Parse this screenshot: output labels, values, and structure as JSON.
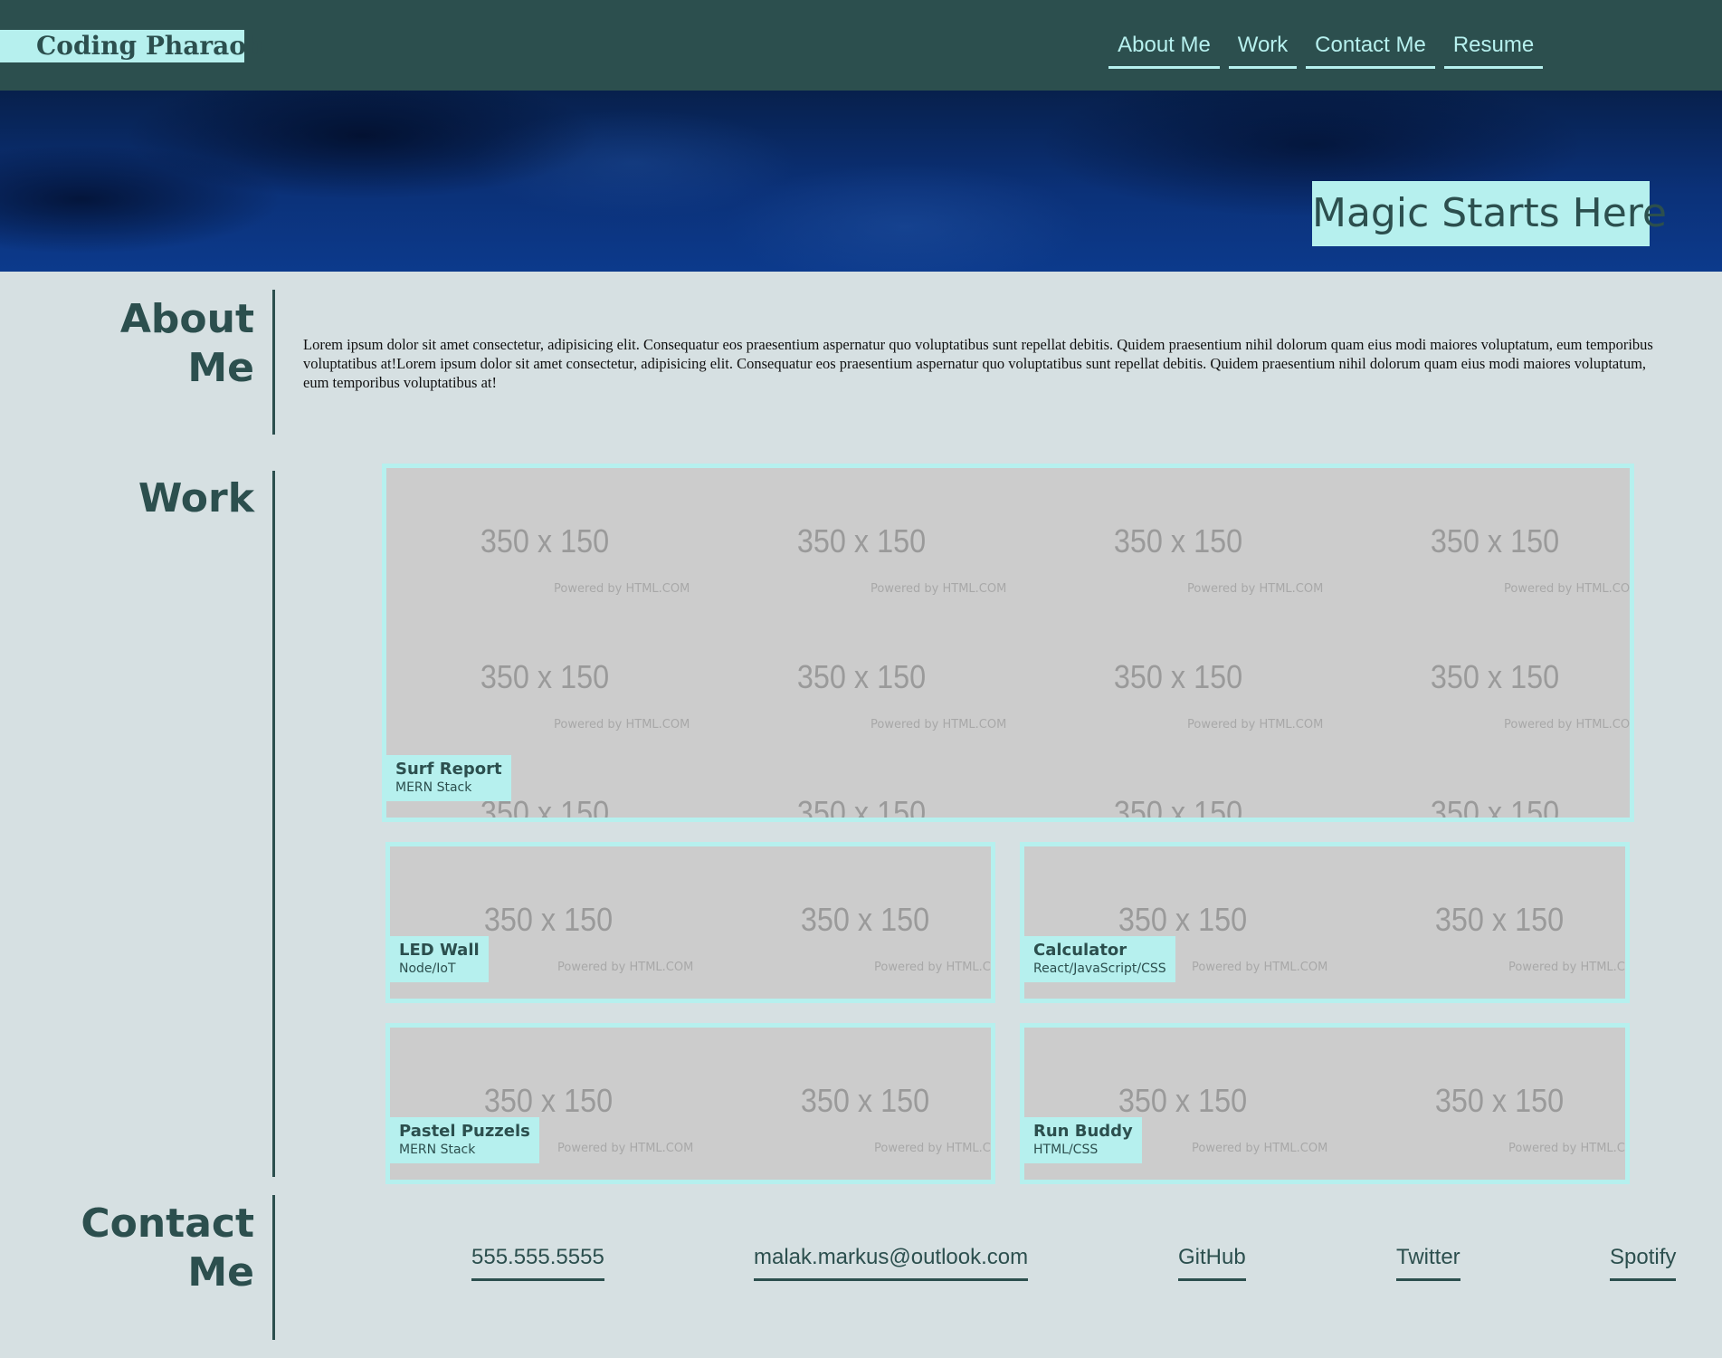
{
  "header": {
    "logo": "Coding Pharaoh",
    "nav": [
      {
        "label": "About Me"
      },
      {
        "label": "Work"
      },
      {
        "label": "Contact Me"
      },
      {
        "label": "Resume"
      }
    ]
  },
  "hero": {
    "title": "Magic Starts Here"
  },
  "about": {
    "heading": "About Me",
    "text": "Lorem ipsum dolor sit amet consectetur, adipisicing elit. Consequatur eos praesentium aspernatur quo voluptatibus sunt repellat debitis. Quidem praesentium nihil dolorum quam eius modi maiores voluptatum, eum temporibus voluptatibus at!Lorem ipsum dolor sit amet consectetur, adipisicing elit. Consequatur eos praesentium aspernatur quo voluptatibus sunt repellat debitis. Quidem praesentium nihil dolorum quam eius modi maiores voluptatum, eum temporibus voluptatibus at!"
  },
  "work": {
    "heading": "Work",
    "placeholder_text": "350 x 150",
    "powered_text": "Powered by HTML.COM",
    "projects": [
      {
        "title": "Surf Report",
        "stack": "MERN Stack"
      },
      {
        "title": "LED Wall",
        "stack": "Node/IoT"
      },
      {
        "title": "Calculator",
        "stack": "React/JavaScript/CSS"
      },
      {
        "title": "Pastel Puzzels",
        "stack": "MERN Stack"
      },
      {
        "title": "Run Buddy",
        "stack": "HTML/CSS"
      }
    ]
  },
  "contact": {
    "heading": "Contact Me",
    "links": [
      {
        "label": "555.555.5555"
      },
      {
        "label": "malak.markus@outlook.com"
      },
      {
        "label": "GitHub"
      },
      {
        "label": "Twitter"
      },
      {
        "label": "Spotify"
      }
    ]
  },
  "colors": {
    "header_bg": "#2c4f4e",
    "accent": "#b6f0ee",
    "page_bg": "#d6e0e2",
    "placeholder_bg": "#cccccc"
  }
}
